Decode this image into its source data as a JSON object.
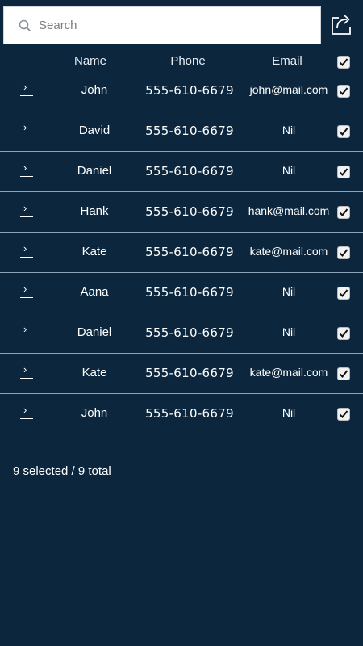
{
  "search": {
    "placeholder": "Search",
    "value": ""
  },
  "toolbar": {
    "share_icon": "share-icon"
  },
  "table": {
    "headers": {
      "name": "Name",
      "phone": "Phone",
      "email": "Email"
    },
    "select_all_checked": true,
    "rows": [
      {
        "name": "John",
        "phone": "555-610-6679",
        "email": "john@mail.com",
        "checked": true
      },
      {
        "name": "David",
        "phone": "555-610-6679",
        "email": "Nil",
        "checked": true
      },
      {
        "name": "Daniel",
        "phone": "555-610-6679",
        "email": "Nil",
        "checked": true
      },
      {
        "name": "Hank",
        "phone": "555-610-6679",
        "email": "hank@mail.com",
        "checked": true
      },
      {
        "name": "Kate",
        "phone": "555-610-6679",
        "email": "kate@mail.com",
        "checked": true
      },
      {
        "name": "Aana",
        "phone": "555-610-6679",
        "email": "Nil",
        "checked": true
      },
      {
        "name": "Daniel",
        "phone": "555-610-6679",
        "email": "Nil",
        "checked": true
      },
      {
        "name": "Kate",
        "phone": "555-610-6679",
        "email": "kate@mail.com",
        "checked": true
      },
      {
        "name": "John",
        "phone": "555-610-6679",
        "email": "Nil",
        "checked": true
      }
    ]
  },
  "footer": {
    "selection_text": "9 selected / 9 total"
  },
  "colors": {
    "background": "#0b263d",
    "row_divider": "#8fa2b4",
    "text": "#ffffff"
  }
}
